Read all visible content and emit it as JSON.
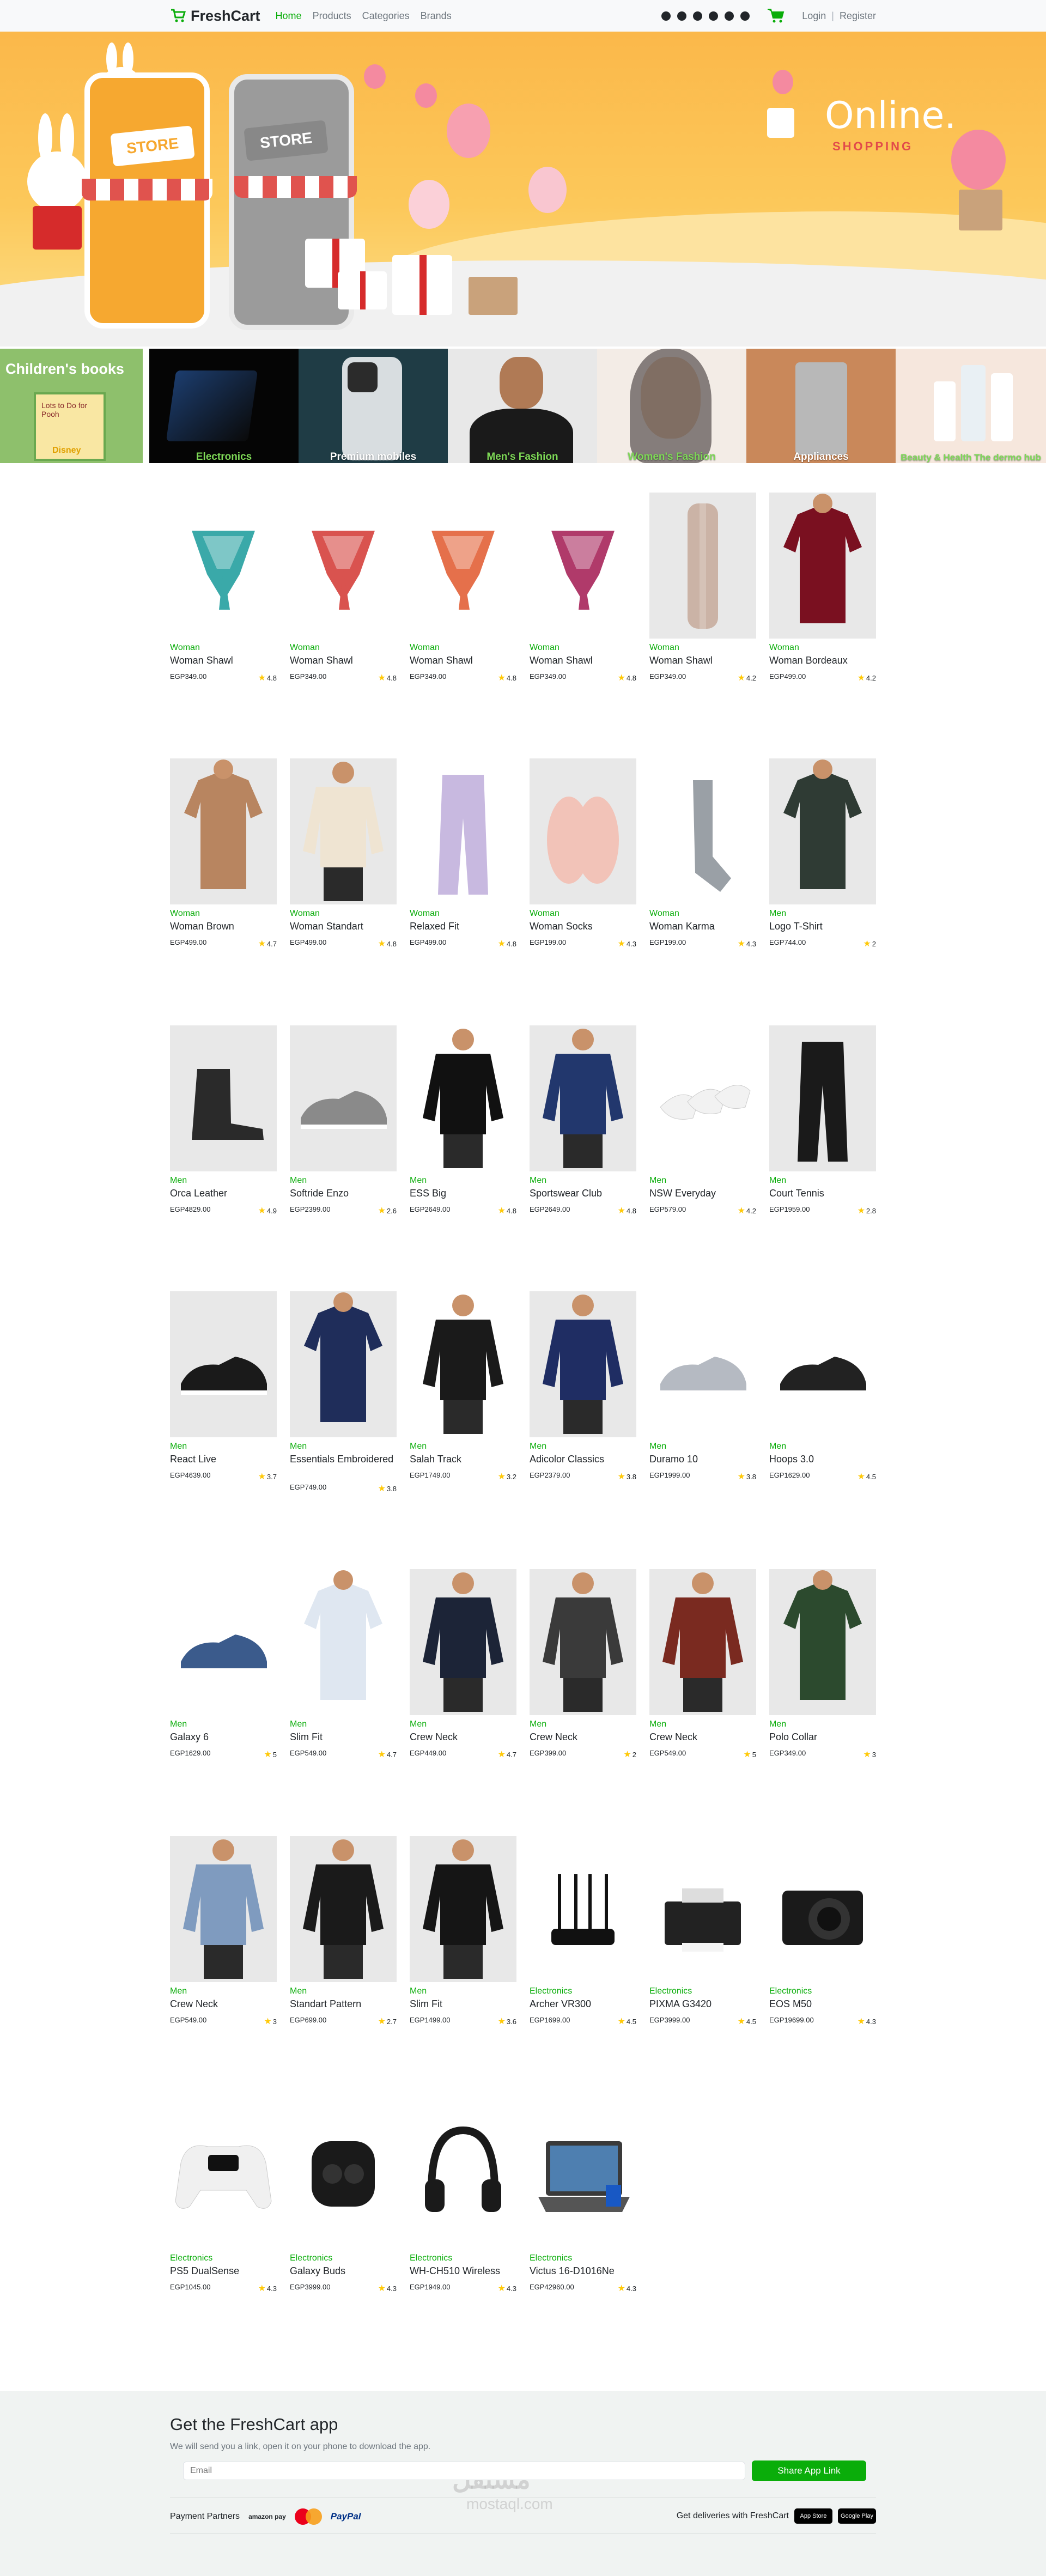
{
  "navbar": {
    "brand": "FreshCart",
    "links": [
      "Home",
      "Products",
      "Categories",
      "Brands"
    ],
    "login": "Login",
    "separator": "|",
    "register": "Register"
  },
  "hero": {
    "store_left": "STORE",
    "store_right": "STORE",
    "title": "Online.",
    "subtitle": "SHOPPING"
  },
  "categories": {
    "books_title": "Children's books",
    "books_cover_title": "Lots to Do for Pooh",
    "books_cover_brand": "Disney",
    "tiles": [
      "Electronics",
      "Premium mobiles",
      "Men's Fashion",
      "Women's Fashion",
      "Appliances",
      "Beauty & Health The dermo hub"
    ]
  },
  "products": [
    {
      "category": "Woman",
      "title": "Woman Shawl",
      "price": "EGP349.00",
      "rating": "4.8"
    },
    {
      "category": "Woman",
      "title": "Woman Shawl",
      "price": "EGP349.00",
      "rating": "4.8"
    },
    {
      "category": "Woman",
      "title": "Woman Shawl",
      "price": "EGP349.00",
      "rating": "4.8"
    },
    {
      "category": "Woman",
      "title": "Woman Shawl",
      "price": "EGP349.00",
      "rating": "4.8"
    },
    {
      "category": "Woman",
      "title": "Woman Shawl",
      "price": "EGP349.00",
      "rating": "4.2"
    },
    {
      "category": "Woman",
      "title": "Woman Bordeaux",
      "price": "EGP499.00",
      "rating": "4.2"
    },
    {
      "category": "Woman",
      "title": "Woman Brown",
      "price": "EGP499.00",
      "rating": "4.7"
    },
    {
      "category": "Woman",
      "title": "Woman Standart",
      "price": "EGP499.00",
      "rating": "4.8"
    },
    {
      "category": "Woman",
      "title": "Relaxed Fit",
      "price": "EGP499.00",
      "rating": "4.8"
    },
    {
      "category": "Woman",
      "title": "Woman Socks",
      "price": "EGP199.00",
      "rating": "4.3"
    },
    {
      "category": "Woman",
      "title": "Woman Karma",
      "price": "EGP199.00",
      "rating": "4.3"
    },
    {
      "category": "Men",
      "title": "Logo T-Shirt",
      "price": "EGP744.00",
      "rating": "2"
    },
    {
      "category": "Men",
      "title": "Orca Leather",
      "price": "EGP4829.00",
      "rating": "4.9"
    },
    {
      "category": "Men",
      "title": "Softride Enzo",
      "price": "EGP2399.00",
      "rating": "2.6"
    },
    {
      "category": "Men",
      "title": "ESS Big",
      "price": "EGP2649.00",
      "rating": "4.8"
    },
    {
      "category": "Men",
      "title": "Sportswear Club",
      "price": "EGP2649.00",
      "rating": "4.8"
    },
    {
      "category": "Men",
      "title": "NSW Everyday",
      "price": "EGP579.00",
      "rating": "4.2"
    },
    {
      "category": "Men",
      "title": "Court Tennis",
      "price": "EGP1959.00",
      "rating": "2.8"
    },
    {
      "category": "Men",
      "title": "React Live",
      "price": "EGP4639.00",
      "rating": "3.7"
    },
    {
      "category": "Men",
      "title": "Essentials Embroidered",
      "price": "EGP749.00",
      "rating": "3.8"
    },
    {
      "category": "Men",
      "title": "Salah Track",
      "price": "EGP1749.00",
      "rating": "3.2"
    },
    {
      "category": "Men",
      "title": "Adicolor Classics",
      "price": "EGP2379.00",
      "rating": "3.8"
    },
    {
      "category": "Men",
      "title": "Duramo 10",
      "price": "EGP1999.00",
      "rating": "3.8"
    },
    {
      "category": "Men",
      "title": "Hoops 3.0",
      "price": "EGP1629.00",
      "rating": "4.5"
    },
    {
      "category": "Men",
      "title": "Galaxy 6",
      "price": "EGP1629.00",
      "rating": "5"
    },
    {
      "category": "Men",
      "title": "Slim Fit",
      "price": "EGP549.00",
      "rating": "4.7"
    },
    {
      "category": "Men",
      "title": "Crew Neck",
      "price": "EGP449.00",
      "rating": "4.7"
    },
    {
      "category": "Men",
      "title": "Crew Neck",
      "price": "EGP399.00",
      "rating": "2"
    },
    {
      "category": "Men",
      "title": "Crew Neck",
      "price": "EGP549.00",
      "rating": "5"
    },
    {
      "category": "Men",
      "title": "Polo Collar",
      "price": "EGP349.00",
      "rating": "3"
    },
    {
      "category": "Men",
      "title": "Crew Neck",
      "price": "EGP549.00",
      "rating": "3"
    },
    {
      "category": "Men",
      "title": "Standart Pattern",
      "price": "EGP699.00",
      "rating": "2.7"
    },
    {
      "category": "Men",
      "title": "Slim Fit",
      "price": "EGP1499.00",
      "rating": "3.6"
    },
    {
      "category": "Electronics",
      "title": "Archer VR300",
      "price": "EGP1699.00",
      "rating": "4.5"
    },
    {
      "category": "Electronics",
      "title": "PIXMA G3420",
      "price": "EGP3999.00",
      "rating": "4.5"
    },
    {
      "category": "Electronics",
      "title": "EOS M50",
      "price": "EGP19699.00",
      "rating": "4.3"
    },
    {
      "category": "Electronics",
      "title": "PS5 DualSense",
      "price": "EGP1045.00",
      "rating": "4.3"
    },
    {
      "category": "Electronics",
      "title": "Galaxy Buds",
      "price": "EGP3999.00",
      "rating": "4.3"
    },
    {
      "category": "Electronics",
      "title": "WH-CH510 Wireless",
      "price": "EGP1949.00",
      "rating": "4.3"
    },
    {
      "category": "Electronics",
      "title": "Victus 16-D1016Ne",
      "price": "EGP42960.00",
      "rating": "4.3"
    }
  ],
  "footer": {
    "title": "Get the FreshCart app",
    "subtitle": "We will send you a link, open it on your phone to download the app.",
    "email_placeholder": "Email",
    "share_button": "Share App Link",
    "payment_label": "Payment Partners",
    "amazon": "amazon pay",
    "paypal": "PayPal",
    "deliveries_label": "Get deliveries with FreshCart",
    "app_store": "App Store",
    "google_play": "Google Play",
    "watermark": "مستقل",
    "watermark_sub": "mostaql.com"
  },
  "colors": {
    "accent": "#0aad0a",
    "star": "#ffc908"
  }
}
